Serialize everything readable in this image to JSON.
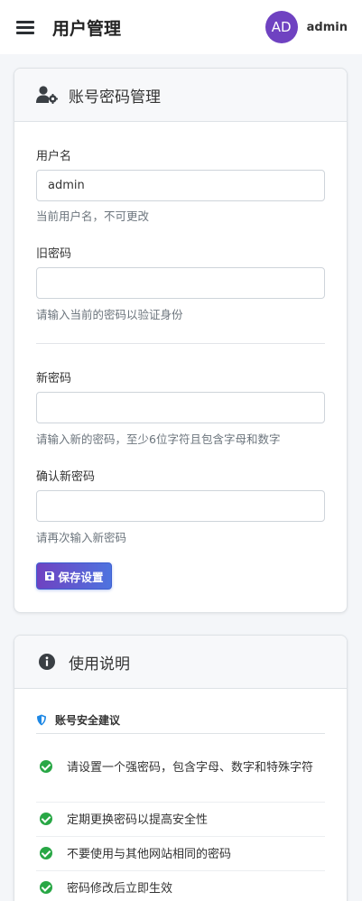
{
  "header": {
    "title": "用户管理",
    "avatar_initials": "AD",
    "username": "admin",
    "menu_icon": "hamburger-icon"
  },
  "account_card": {
    "title": "账号密码管理",
    "icon": "user-gear-icon",
    "username_label": "用户名",
    "username_value": "admin",
    "username_help": "当前用户名，不可更改",
    "old_password_label": "旧密码",
    "old_password_value": "",
    "old_password_help": "请输入当前的密码以验证身份",
    "new_password_label": "新密码",
    "new_password_value": "",
    "new_password_help": "请输入新的密码，至少6位字符且包含字母和数字",
    "confirm_password_label": "确认新密码",
    "confirm_password_value": "",
    "confirm_password_help": "请再次输入新密码",
    "save_label": "保存设置",
    "save_icon": "floppy-disk-icon"
  },
  "instructions_card": {
    "title": "使用说明",
    "icon": "info-circle-icon",
    "section_title": "账号安全建议",
    "section_icon": "shield-icon",
    "tips": [
      "请设置一个强密码，包含字母、数字和特殊字符",
      "定期更换密码以提高安全性",
      "不要使用与其他网站相同的密码",
      "密码修改后立即生效"
    ]
  },
  "colors": {
    "avatar": "#6f42c1",
    "button_gradient_start": "#6f42c1",
    "button_gradient_end": "#4e73df",
    "check": "#28a745",
    "shield": "#1e88e5"
  }
}
